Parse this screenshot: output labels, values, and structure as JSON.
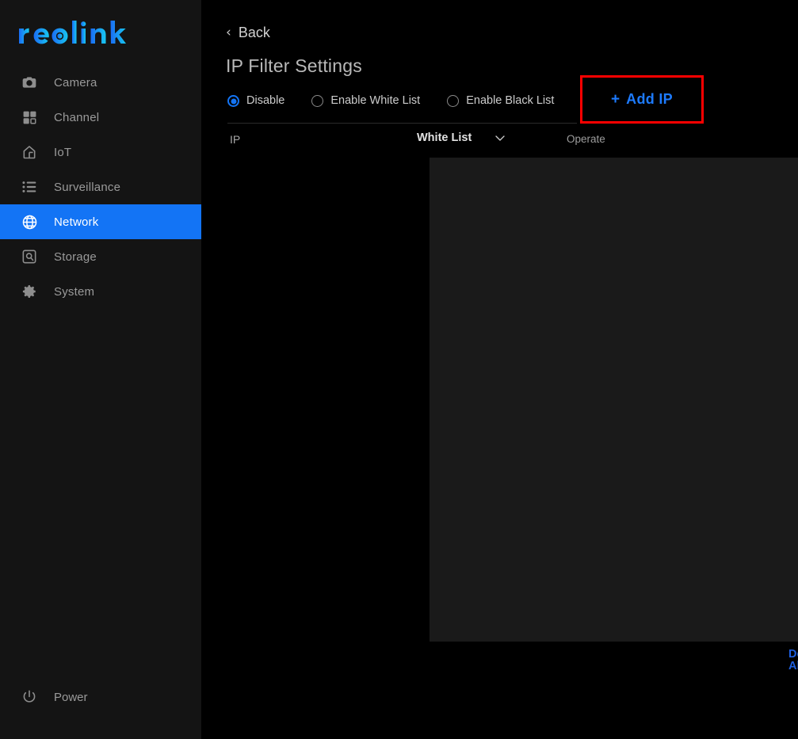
{
  "brand": {
    "logo_text": "reolink",
    "logo_color_start": "#1a6cf5",
    "logo_color_end": "#18c8f0"
  },
  "colors": {
    "accent_blue": "#1374f5",
    "link_blue": "#1d7bff",
    "highlight_red": "#fe0000",
    "sidebar_bg": "#141414",
    "page_bg": "#000000",
    "table_bg": "#1a1a1a"
  },
  "sidebar": {
    "items": [
      {
        "label": "Camera",
        "icon": "camera-icon",
        "active": false
      },
      {
        "label": "Channel",
        "icon": "grid-icon",
        "active": false
      },
      {
        "label": "IoT",
        "icon": "home-icon",
        "active": false
      },
      {
        "label": "Surveillance",
        "icon": "list-icon",
        "active": false
      },
      {
        "label": "Network",
        "icon": "globe-icon",
        "active": true
      },
      {
        "label": "Storage",
        "icon": "hard-drive-icon",
        "active": false
      },
      {
        "label": "System",
        "icon": "gear-icon",
        "active": false
      }
    ],
    "power": {
      "label": "Power",
      "icon": "power-icon"
    }
  },
  "main": {
    "back": {
      "label": "Back",
      "icon": "chevron-left-icon"
    },
    "title": "IP Filter Settings",
    "modes": [
      {
        "label": "Disable",
        "selected": true
      },
      {
        "label": "Enable White List",
        "selected": false
      },
      {
        "label": "Enable Black List",
        "selected": false
      }
    ],
    "add_ip": {
      "plus": "+",
      "label": "Add IP"
    },
    "table": {
      "columns": {
        "ip": "IP",
        "list_type_selected": "White List",
        "operate": "Operate"
      },
      "rows": []
    },
    "delete_all": "Delete All"
  }
}
